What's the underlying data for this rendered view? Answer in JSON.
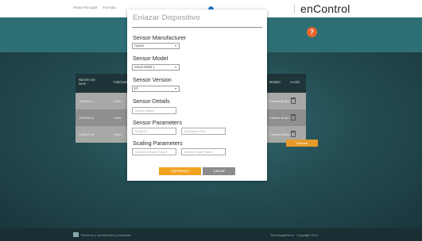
{
  "topbar": {
    "nav_items": [
      "Panel Principal",
      "Formato",
      "",
      ""
    ],
    "link": "",
    "brand": "enControl"
  },
  "help_button": "?",
  "background_table": {
    "headers": [
      "Número de serie",
      "Fabricante",
      "Modelo",
      "Acción"
    ],
    "rows": [
      {
        "serial": "1580241-1",
        "maker": "Delta",
        "model": "Fabrica Bosko"
      },
      {
        "serial": "1580264-6",
        "maker": "Delta",
        "model": "Fabrica Bosko"
      },
      {
        "serial": "1580270-8",
        "maker": "Delta",
        "model": "Fabrica Bosko"
      }
    ],
    "action_button": "Guardar"
  },
  "footer": {
    "left": "Términos y condiciones | privacidad",
    "right": "TecnologiaDemo · Copyright 2017"
  },
  "modal": {
    "title": "Enlazar Dispositivo",
    "manufacturer": {
      "label": "Sensor Manufacturer",
      "value": "Apator"
    },
    "model": {
      "label": "Sensor Model",
      "value": "Smart EMM 1"
    },
    "version": {
      "label": "Sensor Version",
      "value": "EF"
    },
    "details": {
      "label": "Sensor Details",
      "name_placeholder": "Sensor Name"
    },
    "parameters": {
      "label": "Sensor Parameters",
      "serial_placeholder": "Serial ID",
      "encryption_placeholder": "Encryption Key"
    },
    "scaling": {
      "label": "Scaling Parameters",
      "unscaled_placeholder": "Unscaled Scale Factor",
      "instant_placeholder": "Instant Scale Factor"
    },
    "add_button": "Add Sensor",
    "cancel_button": "Cancel"
  },
  "colors": {
    "accent": "#f2a221",
    "help": "#e8642f",
    "teal": "#2e6f76",
    "cancel": "#8c8c8c"
  }
}
